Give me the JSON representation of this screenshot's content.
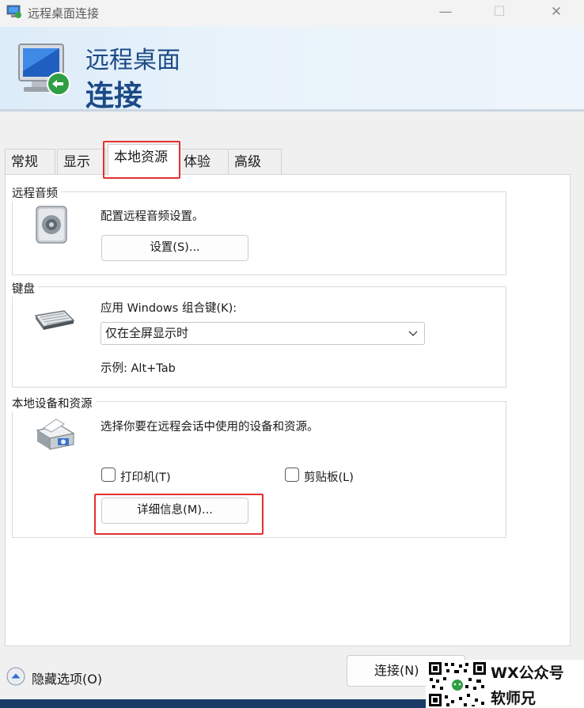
{
  "window": {
    "title": "远程桌面连接",
    "controls": {
      "minimize": "—",
      "maximize": "☐",
      "close": "✕"
    }
  },
  "banner": {
    "line1": "远程桌面",
    "line2": "连接"
  },
  "tabs": [
    {
      "label": "常规",
      "active": false
    },
    {
      "label": "显示",
      "active": false
    },
    {
      "label": "本地资源",
      "active": true
    },
    {
      "label": "体验",
      "active": false
    },
    {
      "label": "高级",
      "active": false
    }
  ],
  "audio": {
    "legend": "远程音频",
    "description": "配置远程音频设置。",
    "settings_button": "设置(S)..."
  },
  "keyboard": {
    "legend": "键盘",
    "apply_label": "应用 Windows 组合键(K):",
    "selected_option": "仅在全屏显示时",
    "example": "示例: Alt+Tab"
  },
  "devices": {
    "legend": "本地设备和资源",
    "description": "选择你要在远程会话中使用的设备和资源。",
    "printer_label": "打印机(T)",
    "printer_checked": false,
    "clipboard_label": "剪贴板(L)",
    "clipboard_checked": false,
    "details_button": "详细信息(M)..."
  },
  "footer": {
    "hide_options": "隐藏选项(O)",
    "connect_button": "连接(N)"
  },
  "watermark": {
    "line1": "WX公众号",
    "line2": "软师兄"
  },
  "colors": {
    "accent": "#1c4a87",
    "highlight": "#e53030"
  },
  "icons": [
    "remote-desktop-icon",
    "speaker-icon",
    "keyboard-icon",
    "printer-icon",
    "chevron-down-icon",
    "chevron-up-circle-icon"
  ]
}
